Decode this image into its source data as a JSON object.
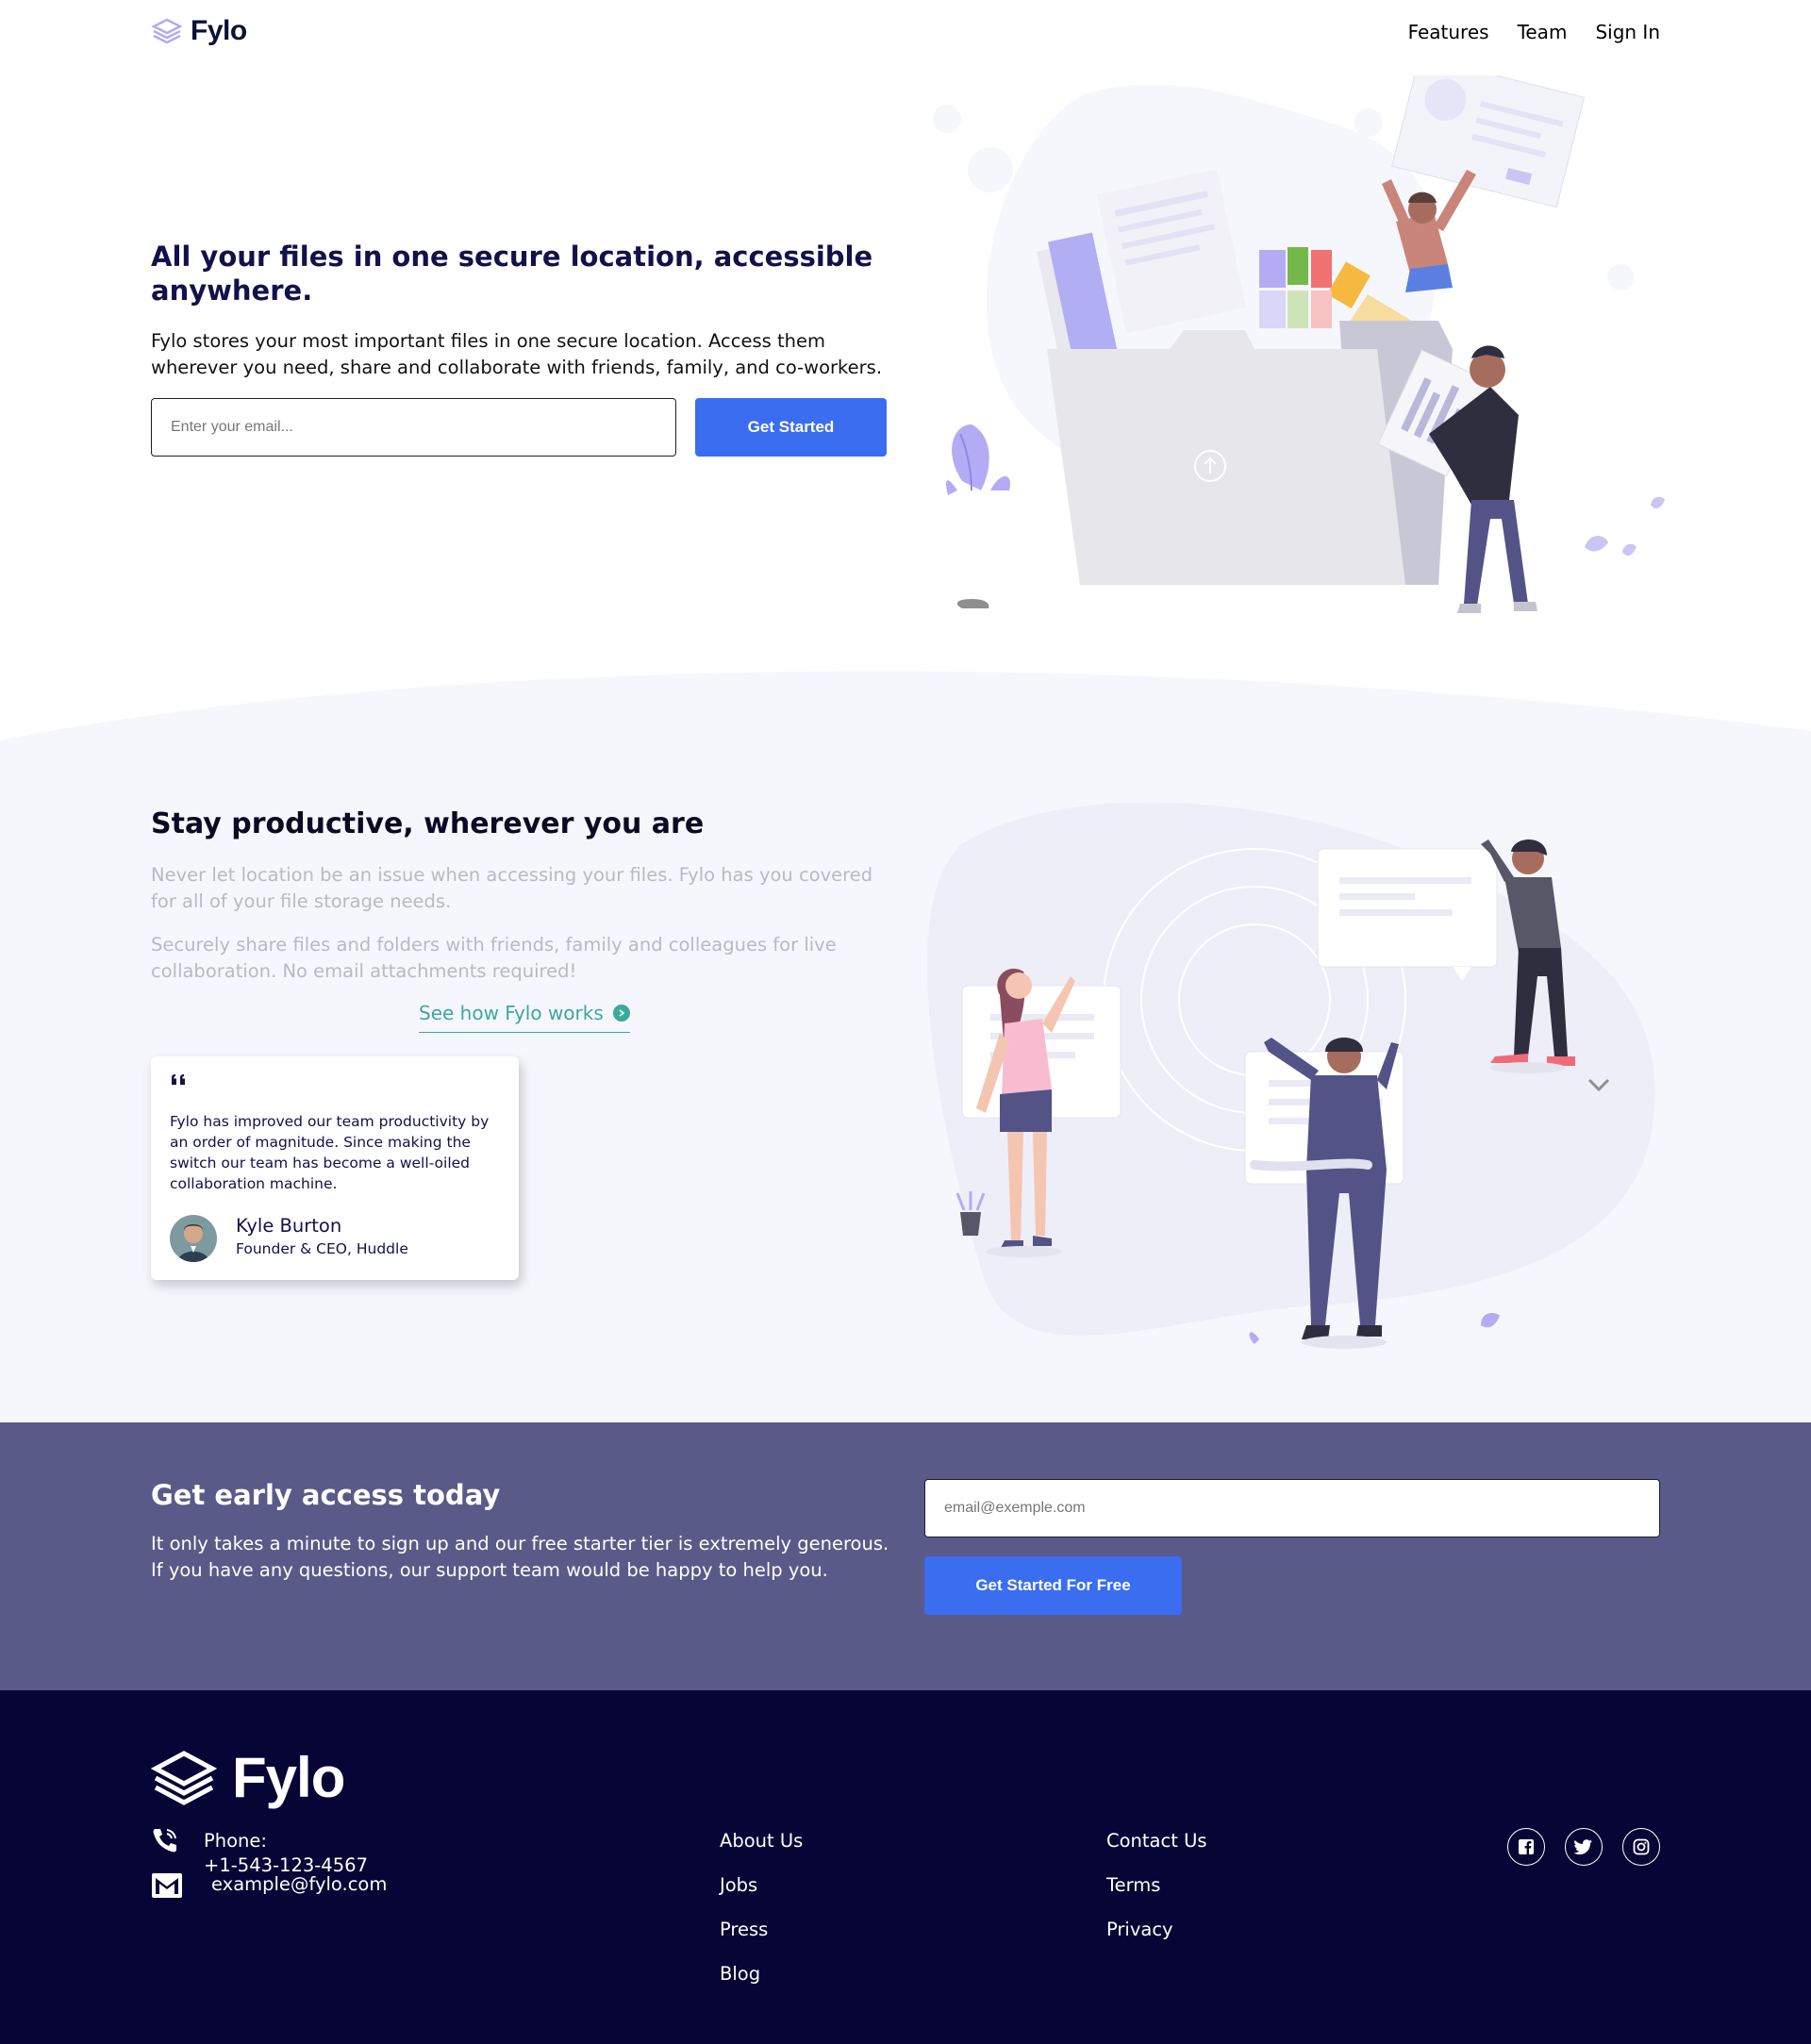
{
  "header": {
    "logo_text": "Fylo",
    "nav": [
      "Features",
      "Team",
      "Sign In"
    ]
  },
  "hero": {
    "title": "All your files in one secure location, accessible anywhere.",
    "description": "Fylo stores your most important files in one secure location. Access them wherever you need, share and collaborate with friends, family, and co-workers.",
    "email_placeholder": "Enter your email...",
    "button_label": "Get Started"
  },
  "productive": {
    "title": "Stay productive, wherever you are",
    "paragraph1": "Never let location be an issue when accessing your files. Fylo has you covered for all of your file storage needs.",
    "paragraph2": "Securely share files and folders with friends, family and colleagues for live collaboration. No email attachments required!",
    "link_label": "See how Fylo works",
    "testimonial": {
      "quote": "Fylo has improved our team productivity by an order of magnitude. Since making the switch our team has become a well-oiled collaboration machine.",
      "name": "Kyle Burton",
      "role": "Founder & CEO, Huddle"
    }
  },
  "early_access": {
    "title": "Get early access today",
    "description": "It only takes a minute to sign up and our free starter tier is extremely generous. If you have any questions, our support team would be happy to help you.",
    "email_placeholder": "email@exemple.com",
    "button_label": "Get Started For Free"
  },
  "footer": {
    "logo_text": "Fylo",
    "phone_label": "Phone:",
    "phone_number": "+1-543-123-4567",
    "email": "example@fylo.com",
    "links_col1": [
      "About Us",
      "Jobs",
      "Press",
      "Blog"
    ],
    "links_col2": [
      "Contact Us",
      "Terms",
      "Privacy"
    ],
    "socials": [
      "facebook-icon",
      "twitter-icon",
      "instagram-icon"
    ]
  },
  "colors": {
    "primary_blue": "#3a6df0",
    "teal": "#3ba99c",
    "dark_navy": "#070535",
    "slate_purple": "#5a5a89",
    "light_bg": "#f6f6fd"
  }
}
